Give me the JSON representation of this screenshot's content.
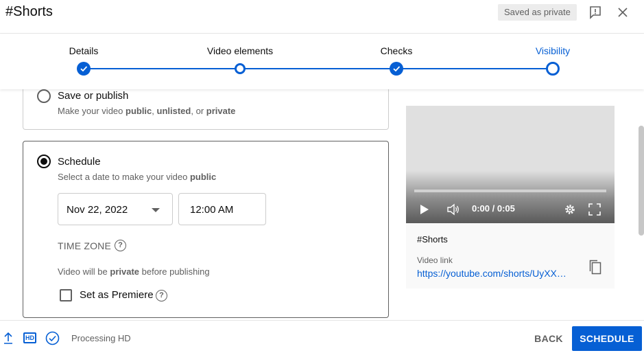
{
  "header": {
    "title": "#Shorts",
    "saved_badge": "Saved as private"
  },
  "stepper": {
    "steps": [
      {
        "label": "Details",
        "state": "done"
      },
      {
        "label": "Video elements",
        "state": "ring"
      },
      {
        "label": "Checks",
        "state": "done"
      },
      {
        "label": "Visibility",
        "state": "current"
      }
    ]
  },
  "options": {
    "save": {
      "title": "Save or publish",
      "desc_prefix": "Make your video ",
      "desc_public": "public",
      "desc_sep1": ", ",
      "desc_unlisted": "unlisted",
      "desc_sep2": ", or ",
      "desc_private": "private"
    },
    "schedule": {
      "title": "Schedule",
      "desc_prefix": "Select a date to make your video ",
      "desc_public": "public",
      "date": "Nov 22, 2022",
      "time": "12:00 AM",
      "timezone_label": "TIME ZONE",
      "help_glyph": "?",
      "private_note_prefix": "Video will be ",
      "private_note_bold": "private",
      "private_note_suffix": " before publishing",
      "premiere_label": "Set as Premiere"
    }
  },
  "preview": {
    "timecode": "0:00 / 0:05",
    "title": "#Shorts",
    "link_label": "Video link",
    "link_url": "https://youtube.com/shorts/UyXXXXXXXXX"
  },
  "footer": {
    "hd_label": "HD",
    "processing": "Processing HD",
    "back_label": "BACK",
    "schedule_label": "SCHEDULE"
  },
  "colors": {
    "accent": "#065fd4",
    "text_secondary": "#606060"
  }
}
